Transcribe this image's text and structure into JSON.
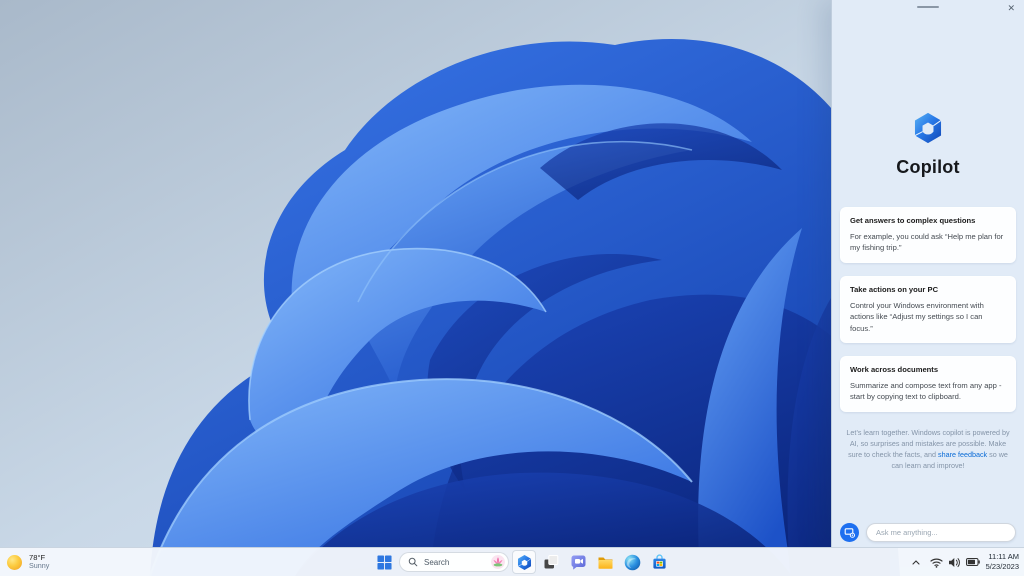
{
  "copilot_panel": {
    "title": "Copilot",
    "close_glyph": "✕",
    "cards": [
      {
        "title": "Get answers to complex questions",
        "body": "For example, you could ask “Help me plan for my fishing trip.”"
      },
      {
        "title": "Take actions on your PC",
        "body": "Control your Windows environment with actions like “Adjust my settings so I can focus.”"
      },
      {
        "title": "Work across documents",
        "body": "Summarize and compose text from any app - start by copying text to clipboard."
      }
    ],
    "disclaimer": {
      "text_before": "Let’s learn together. Windows copilot is powered by AI, so surprises and mistakes are possible. Make sure to check the facts, and ",
      "link_label": "share feedback",
      "text_after": " so we can learn and improve!"
    },
    "input": {
      "placeholder": "Ask me anything...",
      "icon": "copilot-badge-icon"
    }
  },
  "taskbar": {
    "weather": {
      "temperature": "78°F",
      "condition": "Sunny",
      "icon": "sun-icon"
    },
    "start": {
      "label": "Start",
      "icon": "windows-start-icon"
    },
    "search": {
      "label": "Search",
      "icon": "search-icon",
      "highlight_icon": "lotus-flower-icon"
    },
    "apps": [
      {
        "label": "Copilot",
        "icon": "copilot-icon",
        "active": true
      },
      {
        "label": "Task View",
        "icon": "task-view-icon",
        "active": false
      },
      {
        "label": "Chat",
        "icon": "chat-icon",
        "active": false
      },
      {
        "label": "File Explorer",
        "icon": "file-explorer-icon",
        "active": false
      },
      {
        "label": "Microsoft Edge",
        "icon": "edge-icon",
        "active": false
      },
      {
        "label": "Microsoft Store",
        "icon": "store-icon",
        "active": false
      }
    ],
    "tray": {
      "icons": [
        "chevron-up-icon",
        "wifi-icon",
        "volume-icon",
        "battery-icon"
      ],
      "time": "11:11 AM",
      "date": "5/23/2023"
    }
  },
  "colors": {
    "accent": "#1d6ff0",
    "panel_bg": "#e1ebf7",
    "card_bg": "#fdfeff",
    "taskbar_bg": "#f3f7fc",
    "link": "#0a6bd6",
    "bloom_deep": "#0d2f8f",
    "bloom_mid": "#2e6ae0",
    "bloom_light": "#7fb4f8"
  }
}
